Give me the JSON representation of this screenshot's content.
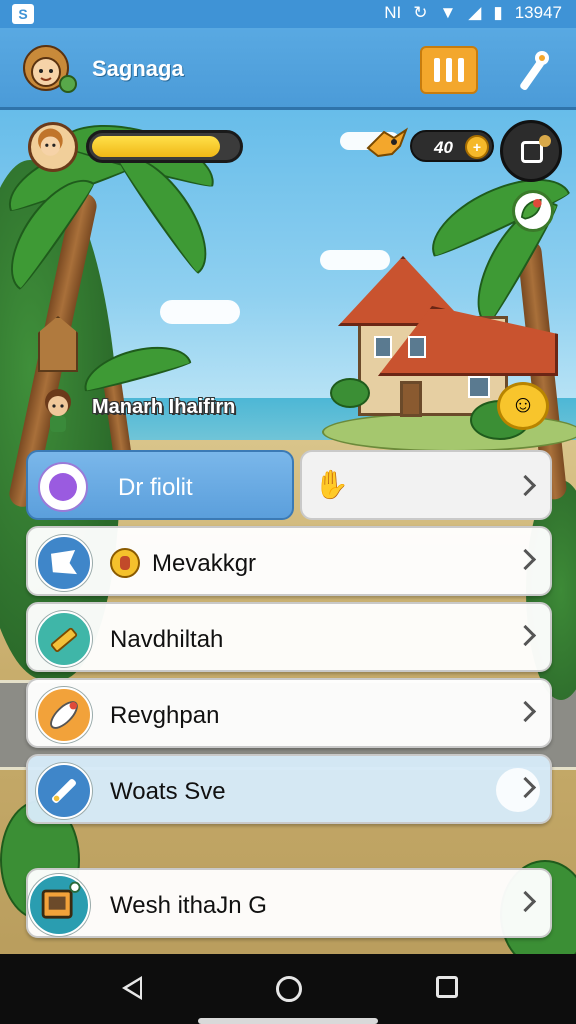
{
  "status_bar": {
    "carrier_icons": "NI",
    "time": "13947"
  },
  "header": {
    "title": "Sagnaga",
    "menu_icon": "pause-bars-icon",
    "wand_icon": "magic-wand-icon"
  },
  "hud": {
    "xp_progress": 0.88,
    "coins": "40",
    "coin_symbol": "+"
  },
  "npc": {
    "name": "Manarh Ihaifirn"
  },
  "menu": {
    "first_left_label": "Dr fiolit",
    "first_right_icon": "waving-hand-icon",
    "items": [
      {
        "label": "Mevakkgr",
        "icon": "map-flag-icon",
        "color": "#3f86c9"
      },
      {
        "label": "Navdhiltah",
        "icon": "pencil-icon",
        "color": "#3fb6a8"
      },
      {
        "label": "Revghpan",
        "icon": "rocket-icon",
        "color": "#f2a23a"
      },
      {
        "label": "Woats Sve",
        "icon": "wrench-icon",
        "color": "#3f86c9"
      },
      {
        "label": "Wesh ithaJn G",
        "icon": "picture-frame-icon",
        "color": "#2a9db0"
      }
    ]
  },
  "colors": {
    "accent": "#4b9bd8",
    "orange": "#f3a72c",
    "xp_yellow": "#f0b816"
  }
}
